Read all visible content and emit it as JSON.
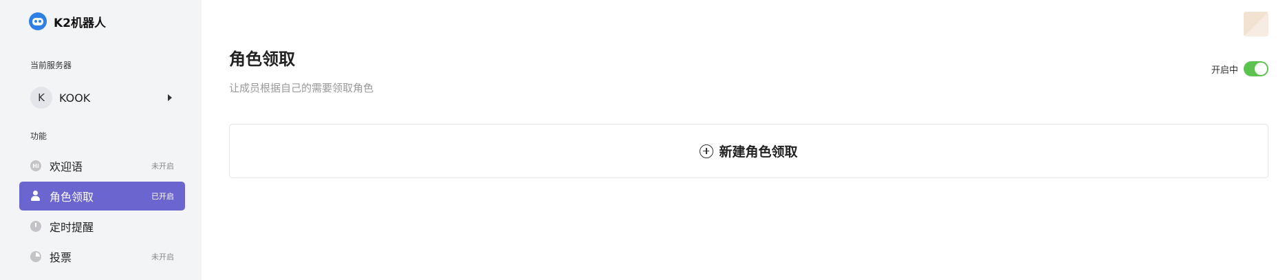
{
  "app": {
    "name": "K2机器人"
  },
  "sidebar": {
    "server_section_label": "当前服务器",
    "server": {
      "avatar_letter": "K",
      "name": "KOOK"
    },
    "features_section_label": "功能",
    "items": [
      {
        "label": "欢迎语",
        "status": "未开启",
        "icon": "hi-icon",
        "active": false
      },
      {
        "label": "角色领取",
        "status": "已开启",
        "icon": "user-role-icon",
        "active": true
      },
      {
        "label": "定时提醒",
        "status": "",
        "icon": "timer-icon",
        "active": false
      },
      {
        "label": "投票",
        "status": "未开启",
        "icon": "pie-chart-icon",
        "active": false
      }
    ]
  },
  "main": {
    "title": "角色领取",
    "subtitle": "让成员根据自己的需要领取角色",
    "toggle": {
      "label": "开启中",
      "on": true
    },
    "new_button_label": "新建角色领取"
  },
  "colors": {
    "accent": "#6b66cf",
    "toggle_on": "#5cc34e",
    "sidebar_bg": "#f3f4f6",
    "brand_blue": "#2f7fe8"
  }
}
